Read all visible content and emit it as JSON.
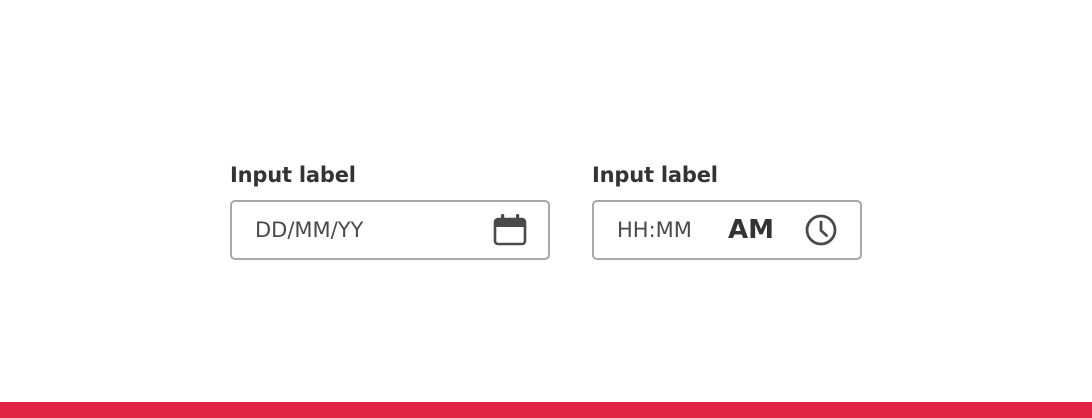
{
  "date_field": {
    "label": "Input label",
    "placeholder": "DD/MM/YY",
    "icon": "calendar-icon"
  },
  "time_field": {
    "label": "Input label",
    "placeholder": "HH:MM",
    "period": "AM",
    "icon": "clock-icon"
  },
  "colors": {
    "accent_bar": "#e22444",
    "border": "#a7a7ad",
    "text": "#333333"
  }
}
